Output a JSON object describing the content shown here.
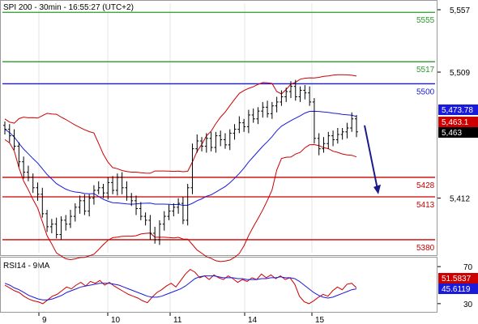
{
  "header": {
    "title": "SPI 200 - 30min - 16:55:27 (UTC+2)"
  },
  "rsi_header": {
    "title": "RSI14 - 9MA"
  },
  "chart_data": [
    {
      "type": "candlestick",
      "title": "SPI 200 - 30min - 16:55:27 (UTC+2)",
      "ylim": [
        5370,
        5562
      ],
      "y_ticks": [
        "5,557",
        "5,509",
        "5,412"
      ],
      "x_ticks": [
        "9",
        "10",
        "11",
        "14",
        "15"
      ],
      "levels": [
        {
          "value": 5555,
          "label": "5555",
          "color": "#2a9a2a"
        },
        {
          "value": 5517,
          "label": "5517",
          "color": "#2a9a2a"
        },
        {
          "value": 5500,
          "label": "5500",
          "color": "#1a1adc"
        },
        {
          "value": 5428,
          "label": "5428",
          "color": "#cc0000"
        },
        {
          "value": 5413,
          "label": "5413",
          "color": "#cc0000"
        },
        {
          "value": 5380,
          "label": "5380",
          "color": "#cc0000"
        }
      ],
      "price_tags": [
        {
          "value": 5473.78,
          "label": "5,473.78",
          "color": "#1a1adc"
        },
        {
          "value": 5463.1,
          "label": "5,463.1",
          "color": "#cc0000"
        },
        {
          "value": 5463,
          "label": "5,463",
          "color": "#000000"
        }
      ],
      "close_series": [
        5465,
        5460,
        5452,
        5440,
        5432,
        5428,
        5420,
        5415,
        5400,
        5390,
        5392,
        5384,
        5395,
        5392,
        5398,
        5405,
        5410,
        5402,
        5412,
        5418,
        5420,
        5416,
        5424,
        5418,
        5428,
        5420,
        5413,
        5410,
        5404,
        5398,
        5395,
        5385,
        5380,
        5392,
        5398,
        5402,
        5405,
        5408,
        5395,
        5420,
        5450,
        5456,
        5452,
        5458,
        5451,
        5460,
        5457,
        5453,
        5462,
        5465,
        5470,
        5467,
        5476,
        5473,
        5479,
        5482,
        5477,
        5483,
        5486,
        5490,
        5494,
        5498,
        5490,
        5495,
        5493,
        5486,
        5458,
        5450,
        5454,
        5460,
        5457,
        5461,
        5463,
        5466,
        5473,
        5463
      ],
      "annotation": {
        "type": "arrow",
        "direction": "down",
        "from": 5468,
        "to": 5415
      }
    },
    {
      "type": "line",
      "title": "RSI14 - 9MA",
      "ylim": [
        22,
        78
      ],
      "y_ticks": [
        "70",
        "30"
      ],
      "series": [
        {
          "name": "RSI14",
          "value_label": "51.5837",
          "color": "#cc0000",
          "values": [
            50,
            47,
            44,
            42,
            38,
            35,
            33,
            32,
            30,
            34,
            38,
            40,
            44,
            48,
            46,
            50,
            53,
            49,
            54,
            52,
            55,
            50,
            53,
            49,
            46,
            43,
            40,
            38,
            36,
            33,
            31,
            37,
            42,
            45,
            49,
            52,
            48,
            55,
            62,
            67,
            64,
            58,
            60,
            56,
            61,
            58,
            56,
            60,
            57,
            53,
            56,
            54,
            58,
            56,
            62,
            58,
            61,
            57,
            60,
            56,
            58,
            51,
            38,
            32,
            30,
            33,
            37,
            40,
            38,
            44,
            48,
            45,
            51,
            52,
            47
          ]
        },
        {
          "name": "9MA",
          "value_label": "45.6119",
          "color": "#1a1adc",
          "values": [
            52,
            50,
            47,
            45,
            42,
            39,
            37,
            35,
            34,
            34,
            35,
            37,
            39,
            42,
            44,
            46,
            48,
            49,
            50,
            51,
            52,
            52,
            52,
            51,
            50,
            48,
            46,
            44,
            42,
            40,
            38,
            37,
            37,
            38,
            40,
            42,
            44,
            46,
            49,
            53,
            57,
            59,
            60,
            60,
            60,
            59,
            58,
            58,
            58,
            57,
            57,
            56,
            56,
            56,
            57,
            57,
            58,
            58,
            59,
            58,
            58,
            57,
            54,
            50,
            46,
            42,
            39,
            37,
            36,
            37,
            39,
            41,
            43,
            45,
            46
          ]
        }
      ],
      "value_tags": [
        {
          "value": 51.5837,
          "label": "51.5837",
          "color": "#cc0000"
        },
        {
          "value": 45.6119,
          "label": "45.6119",
          "color": "#1a1adc"
        }
      ]
    }
  ]
}
